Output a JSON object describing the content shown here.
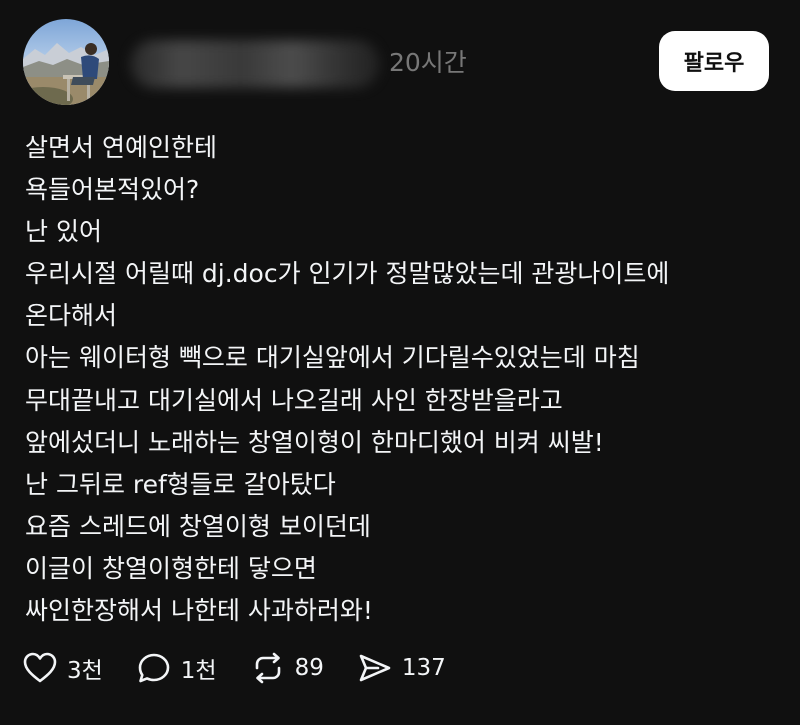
{
  "post": {
    "timestamp": "20시간",
    "follow_label": "팔로우",
    "lines": [
      "살면서 연예인한테",
      "욕들어본적있어?",
      "난 있어",
      "우리시절 어릴때 dj.doc가 인기가 정말많았는데 관광나이트에",
      "온다해서",
      "아는 웨이터형 빽으로 대기실앞에서 기다릴수있었는데 마침",
      "무대끝내고 대기실에서 나오길래 사인 한장받을라고",
      "앞에섰더니 노래하는 창열이형이 한마디했어 비켜 씨발!",
      "난 그뒤로 ref형들로 갈아탔다",
      "요즘 스레드에 창열이형 보이던데",
      "이글이 창열이형한테 닿으면",
      "싸인한장해서 나한테 사과하러와!"
    ],
    "actions": {
      "like_count": "3천",
      "comment_count": "1천",
      "repost_count": "89",
      "share_count": "137"
    }
  },
  "icons": {
    "like": "heart-icon",
    "comment": "comment-bubble-icon",
    "repost": "repost-icon",
    "share": "send-icon"
  },
  "colors": {
    "background": "#101010",
    "text": "#f3f5f7",
    "muted": "#777777",
    "button_bg": "#ffffff"
  }
}
